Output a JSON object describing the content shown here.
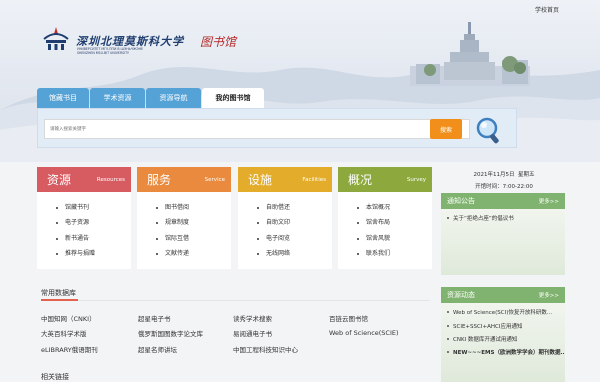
{
  "header": {
    "top_link": "学校首页",
    "university_name_cn": "深圳北理莫斯科大学",
    "library_title": "图书馆",
    "university_name_en_1": "УНИВЕРСИТЕТ МГУ-ППИ В ШЭНЬЧЖЭНЕ",
    "university_name_en_2": "SHENZHEN MSU-BIT UNIVERSITY"
  },
  "colors": {
    "tab_blue": "#55a2d6",
    "search_orange": "#f18f1a",
    "panel_green": "#7fb36f",
    "card_red": "#d75c62",
    "card_orange": "#e98a3e",
    "card_yellow": "#e3ac2a",
    "card_green": "#8da93d",
    "section_accent": "#e2624d"
  },
  "tabs": [
    {
      "label": "馆藏书目"
    },
    {
      "label": "学术资源"
    },
    {
      "label": "资源导航"
    },
    {
      "label": "我的图书馆"
    }
  ],
  "search": {
    "placeholder": "请输入搜索关键字",
    "button_label": "搜索",
    "icon": "magnifier-icon"
  },
  "cards": [
    {
      "title": "资源",
      "subtitle": "Resources",
      "items": [
        "馆藏书刊",
        "电子资源",
        "新书通告",
        "推荐与捐赠"
      ]
    },
    {
      "title": "服务",
      "subtitle": "Service",
      "items": [
        "图书借阅",
        "规章制度",
        "馆际互借",
        "文献传递"
      ]
    },
    {
      "title": "设施",
      "subtitle": "Facilities",
      "items": [
        "自助借还",
        "自助文印",
        "电子阅览",
        "无线网络"
      ]
    },
    {
      "title": "概况",
      "subtitle": "Survey",
      "items": [
        "本馆概况",
        "馆舍布局",
        "馆舍风貌",
        "联系我们"
      ]
    }
  ],
  "info": {
    "date": "2021年11月5日",
    "weekday": "星期五",
    "hours_label": "开馆时间：",
    "hours_value": "7:00-22:00"
  },
  "notice_panel": {
    "title": "通知公告",
    "more": "更多>>",
    "items": [
      "关于“拒绝占座”的倡议书"
    ]
  },
  "news_panel": {
    "title": "资源动态",
    "more": "更多>>",
    "items": [
      "Web of Science(SCI)恢复开放科研数...",
      "SCIE+SSCI+AHCI应用通知",
      "CNKI 数据库开通试用通知",
      "NEW~~~EMS（欧洲数学学会）期刊数据..."
    ]
  },
  "databases": {
    "title": "常用数据库",
    "rows": [
      [
        "中国知网（CNKI）",
        "超星电子书",
        "读秀学术搜索",
        "百链云图书馆"
      ],
      [
        "大英百科学术版",
        "俄罗斯国图数字论文库",
        "易阅通电子书",
        "Web of Science(SCIE)"
      ],
      [
        "eLIBRARY俄语期刊",
        "超星名师讲坛",
        "中国工程科技知识中心",
        ""
      ]
    ]
  },
  "related_links": {
    "title": "相关链接"
  }
}
